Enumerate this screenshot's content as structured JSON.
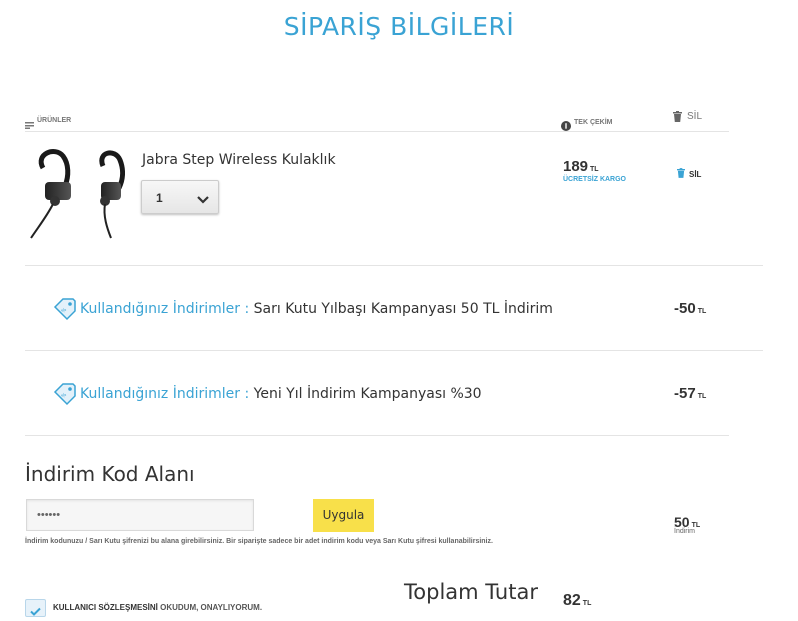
{
  "page": {
    "title": "SİPARİŞ BİLGİLERİ"
  },
  "table_header": {
    "products": "ÜRÜNLER",
    "single_payment": "TEK ÇEKİM",
    "delete": "SİL"
  },
  "product": {
    "name": "Jabra Step Wireless Kulaklık",
    "quantity": "1",
    "price": "189",
    "currency": "TL",
    "shipping": "ÜCRETSİZ KARGO",
    "delete": "SİL"
  },
  "discounts": [
    {
      "label": "Kullandığınız İndirimler :",
      "text": "Sarı Kutu Yılbaşı Kampanyası 50 TL İndirim",
      "amount": "-50",
      "currency": "TL"
    },
    {
      "label": "Kullandığınız İndirimler :",
      "text": "Yeni Yıl İndirim Kampanyası %30",
      "amount": "-57",
      "currency": "TL"
    }
  ],
  "discount_code": {
    "heading": "İndirim Kod Alanı",
    "input_value": "••••••",
    "apply_label": "Uygula",
    "note": "İndirim kodunuzu / Sarı Kutu şifrenizi bu alana girebilirsiniz. Bir siparişte sadece bir adet indirim kodu veya Sarı Kutu şifresi kullanabilirsiniz.",
    "amount": "50",
    "currency": "TL",
    "sub": "İndirim"
  },
  "total": {
    "label": "Toplam Tutar",
    "amount": "82",
    "currency": "TL"
  },
  "agreement": {
    "strong": "KULLANICI SÖZLEŞMESİNİ",
    "rest": " OKUDUM, ONAYLIYORUM."
  },
  "colors": {
    "accent": "#3aa3d4",
    "button": "#f8e04a"
  }
}
